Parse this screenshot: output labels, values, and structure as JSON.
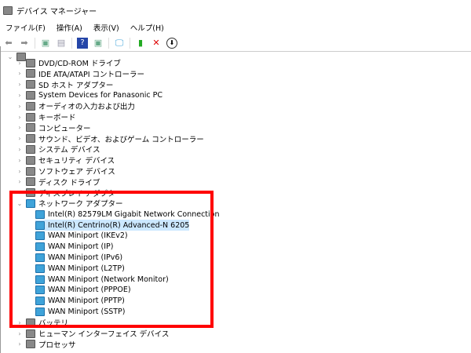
{
  "window": {
    "title": "デバイス マネージャー"
  },
  "menu": [
    "ファイル(F)",
    "操作(A)",
    "表示(V)",
    "ヘルプ(H)"
  ],
  "toolbar": [
    "back-icon",
    "forward-icon",
    "properties-icon",
    "update-icon",
    "help-icon",
    "run-icon",
    "monitor-icon",
    "enable-device-icon",
    "uninstall-icon",
    "download-icon"
  ],
  "tree": {
    "categories_top": [
      "DVD/CD-ROM ドライブ",
      "IDE ATA/ATAPI コントローラー",
      "SD ホスト アダプター",
      "System Devices for Panasonic PC",
      "オーディオの入力および出力",
      "キーボード",
      "コンピューター",
      "サウンド、ビデオ、およびゲーム コントローラー",
      "システム デバイス",
      "セキュリティ デバイス",
      "ソフトウェア デバイス",
      "ディスク ドライブ",
      "ディスプレイ アダプター"
    ],
    "network": {
      "label": "ネットワーク アダプター",
      "children": [
        "Intel(R) 82579LM Gigabit Network Connection",
        "Intel(R) Centrino(R) Advanced-N 6205",
        "WAN Miniport (IKEv2)",
        "WAN Miniport (IP)",
        "WAN Miniport (IPv6)",
        "WAN Miniport (L2TP)",
        "WAN Miniport (Network Monitor)",
        "WAN Miniport (PPPOE)",
        "WAN Miniport (PPTP)",
        "WAN Miniport (SSTP)"
      ],
      "selected_index": 1
    },
    "categories_bottom": [
      "バッテリ",
      "ヒューマン インターフェイス デバイス",
      "プロセッサ"
    ]
  },
  "colors": {
    "highlight": "#ff0000",
    "selection": "#cce8ff"
  }
}
